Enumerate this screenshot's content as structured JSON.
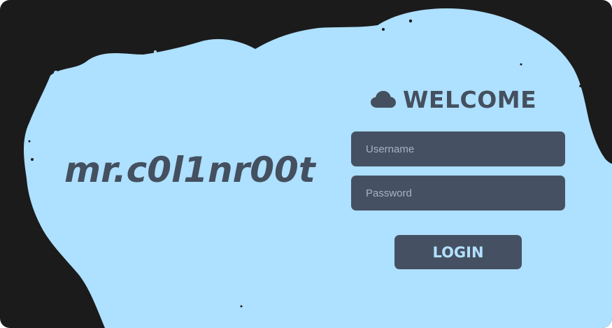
{
  "colors": {
    "background": "#1b1b1c",
    "splash": "#aee0ff",
    "accent_dark": "#44505f",
    "button_text": "#b3e0ff"
  },
  "brand": {
    "title": "mr.c0l1nr00t"
  },
  "login_form": {
    "heading": "WELCOME",
    "heading_icon": "cloud-icon",
    "username_placeholder": "Username",
    "username_value": "",
    "password_placeholder": "Password",
    "password_value": "",
    "submit_label": "LOGIN"
  }
}
